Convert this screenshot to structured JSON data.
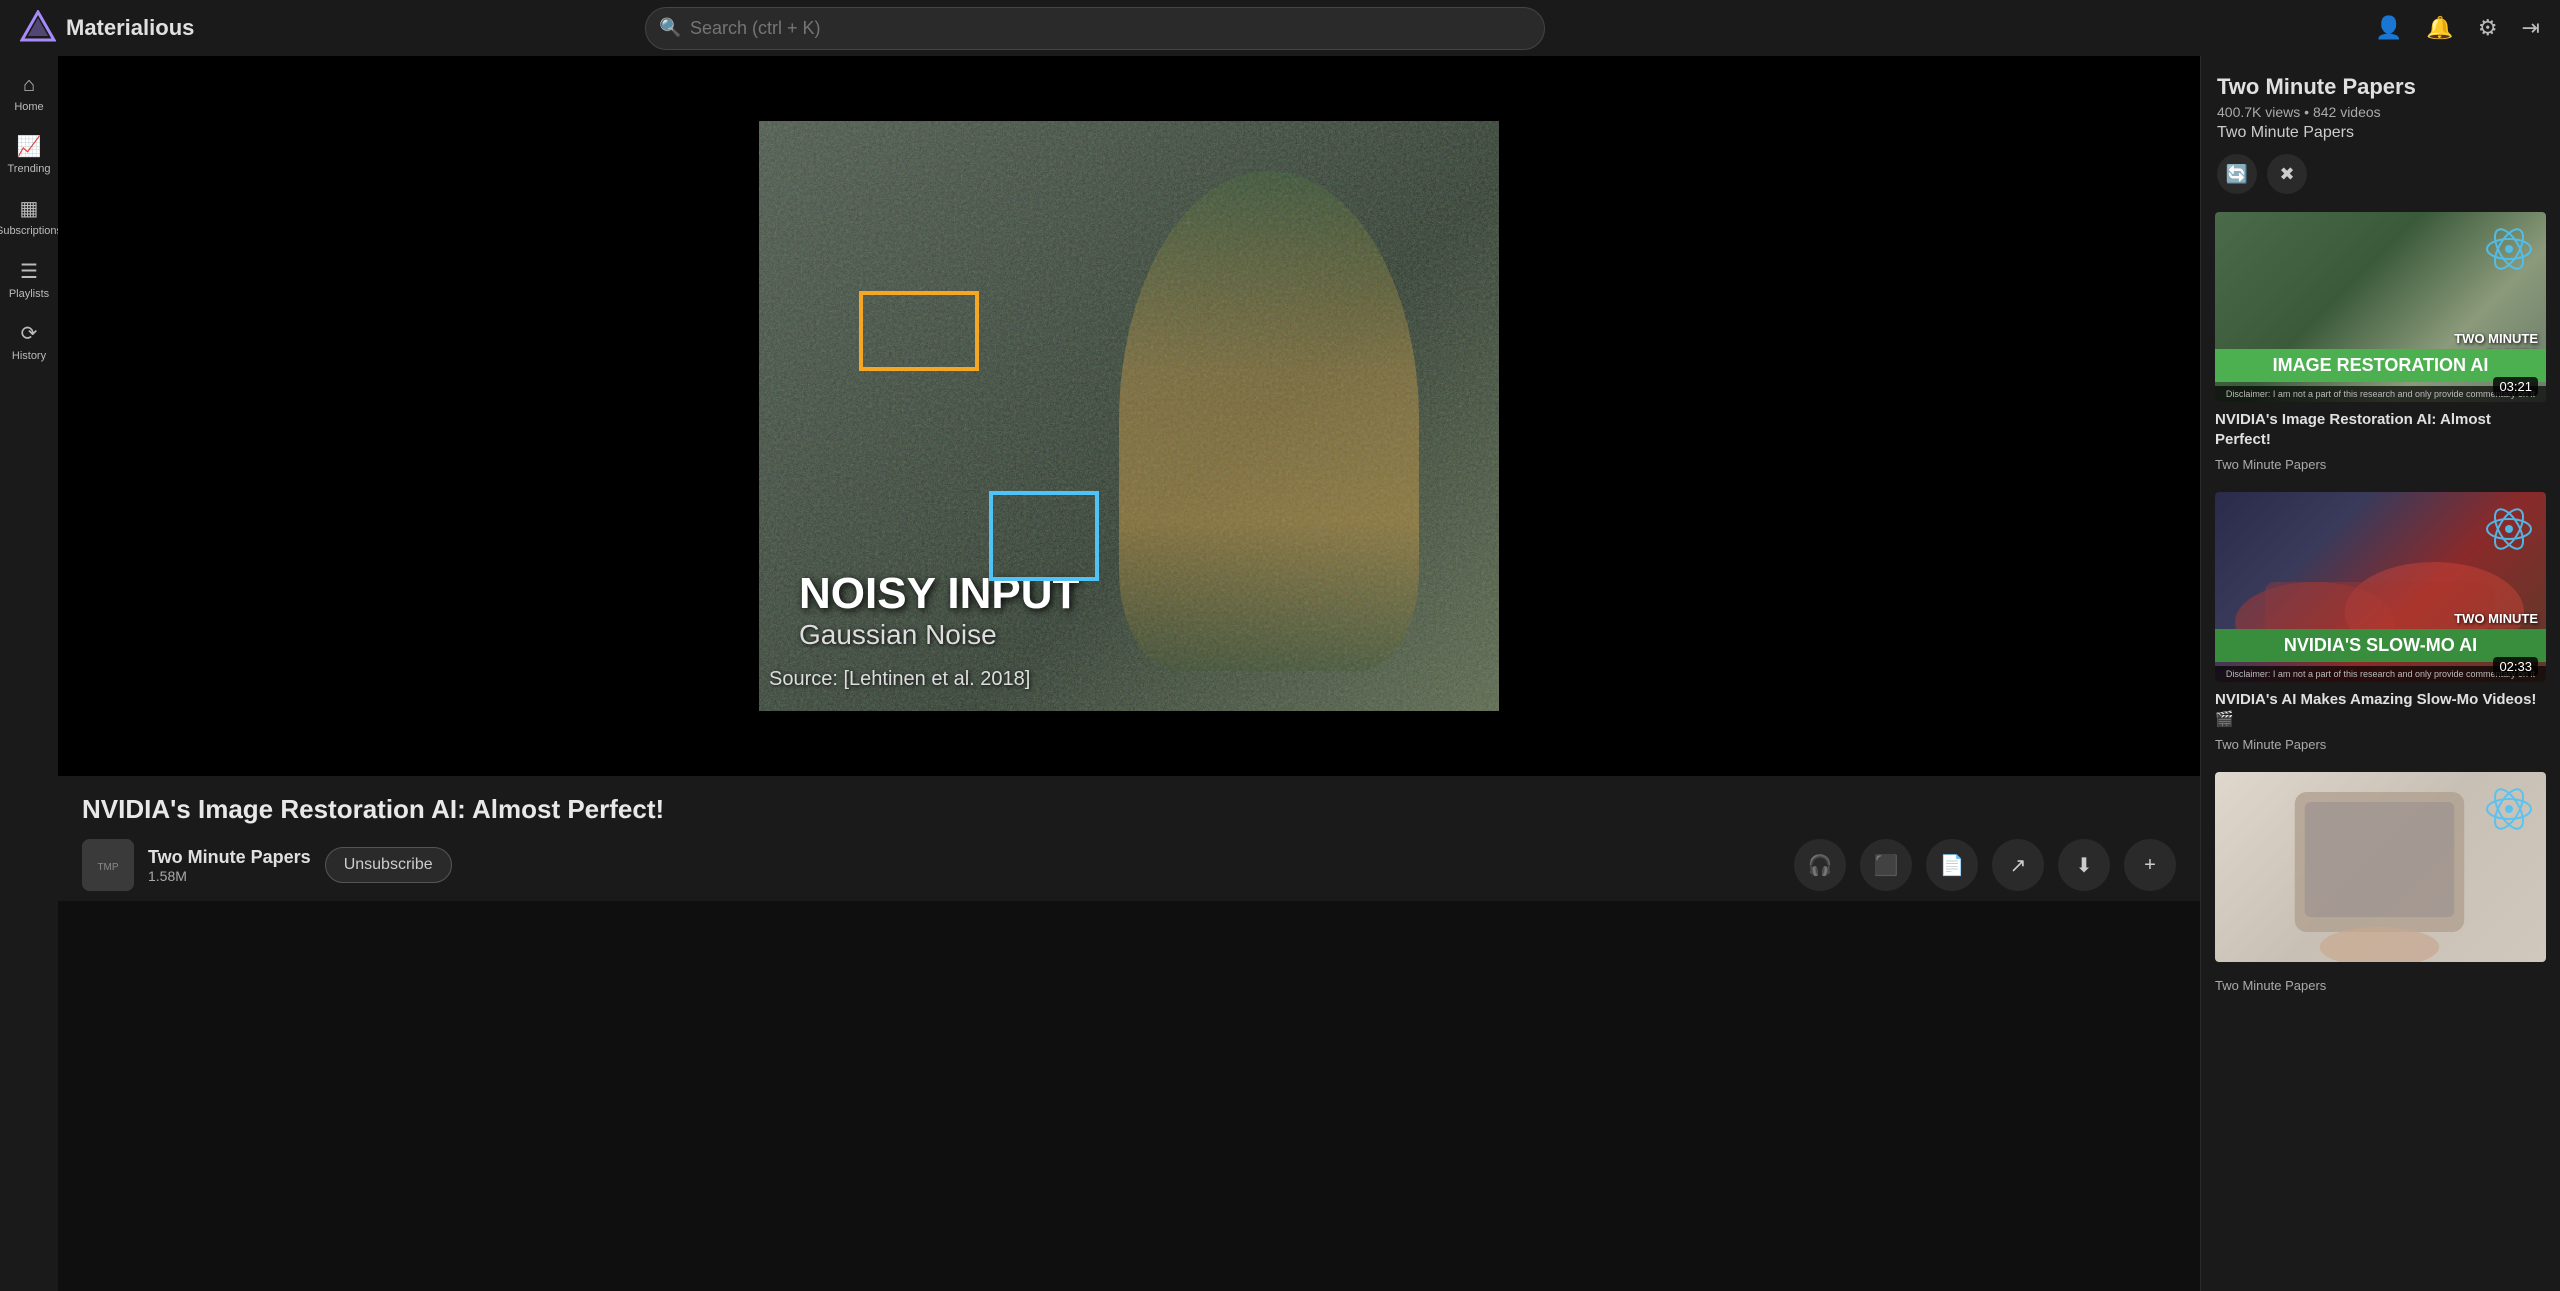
{
  "app": {
    "name": "Materialious",
    "logo_glyph": "▷"
  },
  "topbar": {
    "search_placeholder": "Search (ctrl + K)",
    "icons": {
      "search": "🔍",
      "account": "👤",
      "bell": "🔔",
      "settings": "⚙",
      "logout": "⇥"
    }
  },
  "sidebar": {
    "items": [
      {
        "id": "home",
        "label": "Home",
        "icon": "⌂"
      },
      {
        "id": "trending",
        "label": "Trending",
        "icon": "📈"
      },
      {
        "id": "subscriptions",
        "label": "Subscriptions",
        "icon": "▦"
      },
      {
        "id": "playlists",
        "label": "Playlists",
        "icon": "☰"
      },
      {
        "id": "history",
        "label": "History",
        "icon": "⟳"
      }
    ]
  },
  "video": {
    "title": "NVIDIA's Image Restoration AI: Almost Perfect!",
    "overlay": {
      "main": "NOISY INPUT",
      "sub": "Gaussian Noise",
      "source": "Source: [Lehtinen et al. 2018]"
    }
  },
  "channel": {
    "name": "Two Minute Papers",
    "subscribers": "1.58M",
    "unsubscribe_label": "Unsubscribe"
  },
  "right_panel": {
    "channel_title": "Two Minute Papers",
    "stats": "400.7K views • 842 videos",
    "channel_name": "Two Minute Papers",
    "action_icons": [
      "🔄",
      "✖"
    ],
    "videos": [
      {
        "title": "NVIDIA's Image Restoration AI: Almost Perfect!",
        "channel": "Two Minute Papers",
        "duration": "03:21",
        "thumb_type": "koala",
        "thumb_overlay": "IMAGE RESTORATION AI"
      },
      {
        "title": "NVIDIA's AI Makes Amazing Slow-Mo Videos! 🎬",
        "channel": "Two Minute Papers",
        "duration": "02:33",
        "thumb_type": "car",
        "thumb_overlay": "NVIDIA'S SLOW-MO AI"
      },
      {
        "title": "",
        "channel": "Two Minute Papers",
        "duration": "",
        "thumb_type": "paper",
        "thumb_overlay": ""
      }
    ]
  },
  "action_buttons": [
    {
      "id": "headphones",
      "icon": "🎧"
    },
    {
      "id": "theater",
      "icon": "⬛"
    },
    {
      "id": "document",
      "icon": "📄"
    },
    {
      "id": "share",
      "icon": "↗"
    },
    {
      "id": "download",
      "icon": "⬇"
    },
    {
      "id": "more",
      "icon": "+"
    }
  ]
}
